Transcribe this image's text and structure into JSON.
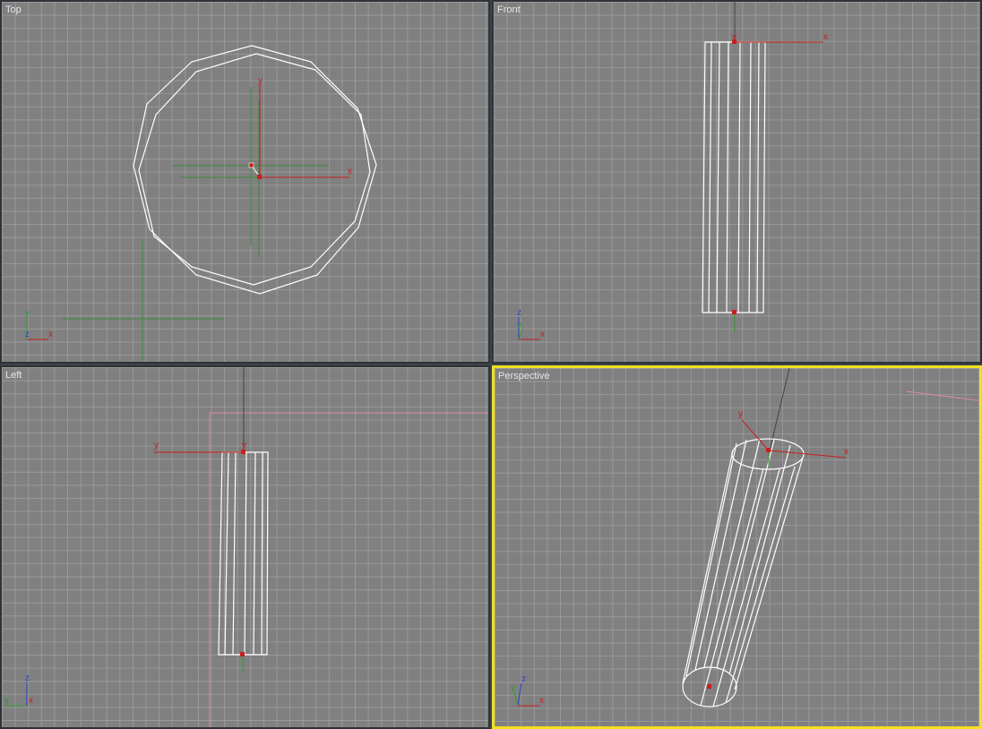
{
  "viewports": [
    {
      "label": "Top",
      "active": false
    },
    {
      "label": "Front",
      "active": false
    },
    {
      "label": "Left",
      "active": false
    },
    {
      "label": "Perspective",
      "active": true
    }
  ],
  "axis_labels": {
    "x": "x",
    "y": "y",
    "z": "z"
  },
  "colors": {
    "viewport_bg": "#808080",
    "grid": "#acacac",
    "active_border": "#f0e020",
    "wire": "#ffffff",
    "axis_x": "#c81e1e",
    "axis_y": "#2f9a2f",
    "axis_z": "#2a3fd0"
  }
}
